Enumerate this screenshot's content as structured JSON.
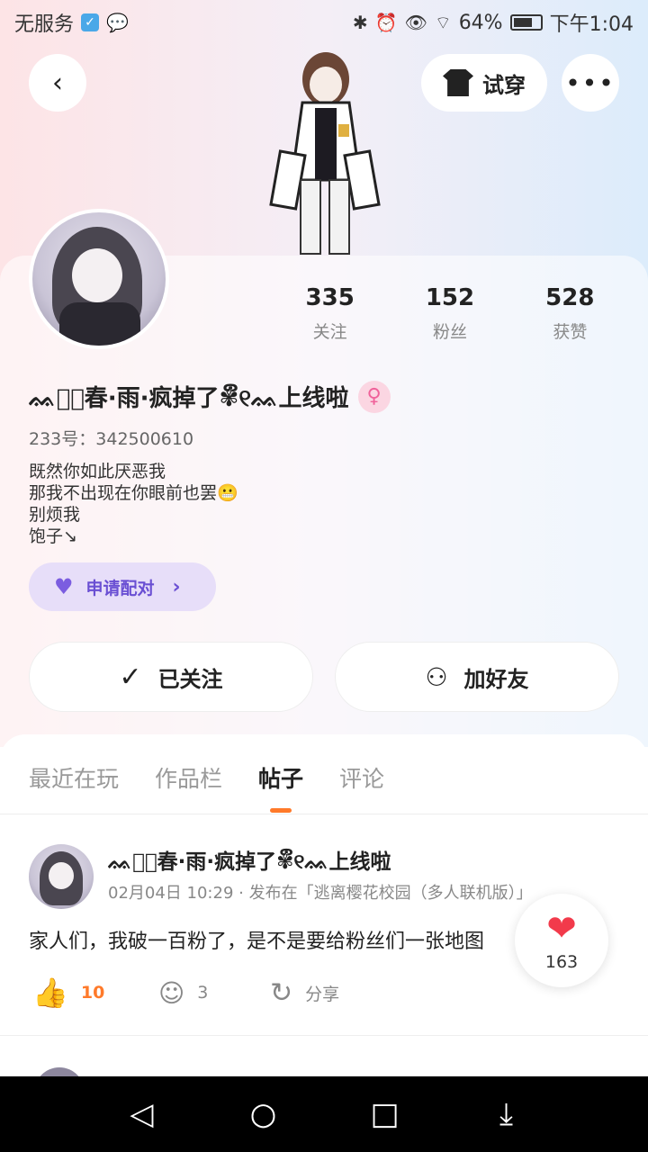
{
  "status_bar": {
    "carrier": "无服务",
    "battery": "64%",
    "time": "下午1:04"
  },
  "header": {
    "tryon_label": "试穿",
    "more_label": "•••"
  },
  "profile": {
    "stats": [
      {
        "value": "335",
        "label": "关注"
      },
      {
        "value": "152",
        "label": "粉丝"
      },
      {
        "value": "528",
        "label": "获赞"
      }
    ],
    "username": "ᨐ᥉ᷠ春·雨·疯掉了✾ຶ୧ᨐ上线啦",
    "uid": "233号：342500610",
    "bio": [
      "既然你如此厌恶我",
      "那我不出现在你眼前也罢😬",
      "别烦我",
      "饱子↘"
    ],
    "pair_label": "申请配对",
    "follow_label": "已关注",
    "add_friend_label": "加好友"
  },
  "tabs": [
    "最近在玩",
    "作品栏",
    "帖子",
    "评论"
  ],
  "post": {
    "author": "ᨐ᥉ᷠ春·雨·疯掉了✾ຶ୧ᨐ上线啦",
    "meta": "02月04日 10:29 · 发布在「逃离樱花校园（多人联机版）」",
    "text": "家人们，我破一百粉了，是不是要给粉丝们一张地图",
    "likes": "10",
    "comments": "3",
    "share_label": "分享"
  },
  "float_like": {
    "count": "163"
  },
  "colors": {
    "accent_orange": "#ff7a2a",
    "pair_purple": "#6a4fd3",
    "heart_red": "#f23a4b"
  }
}
